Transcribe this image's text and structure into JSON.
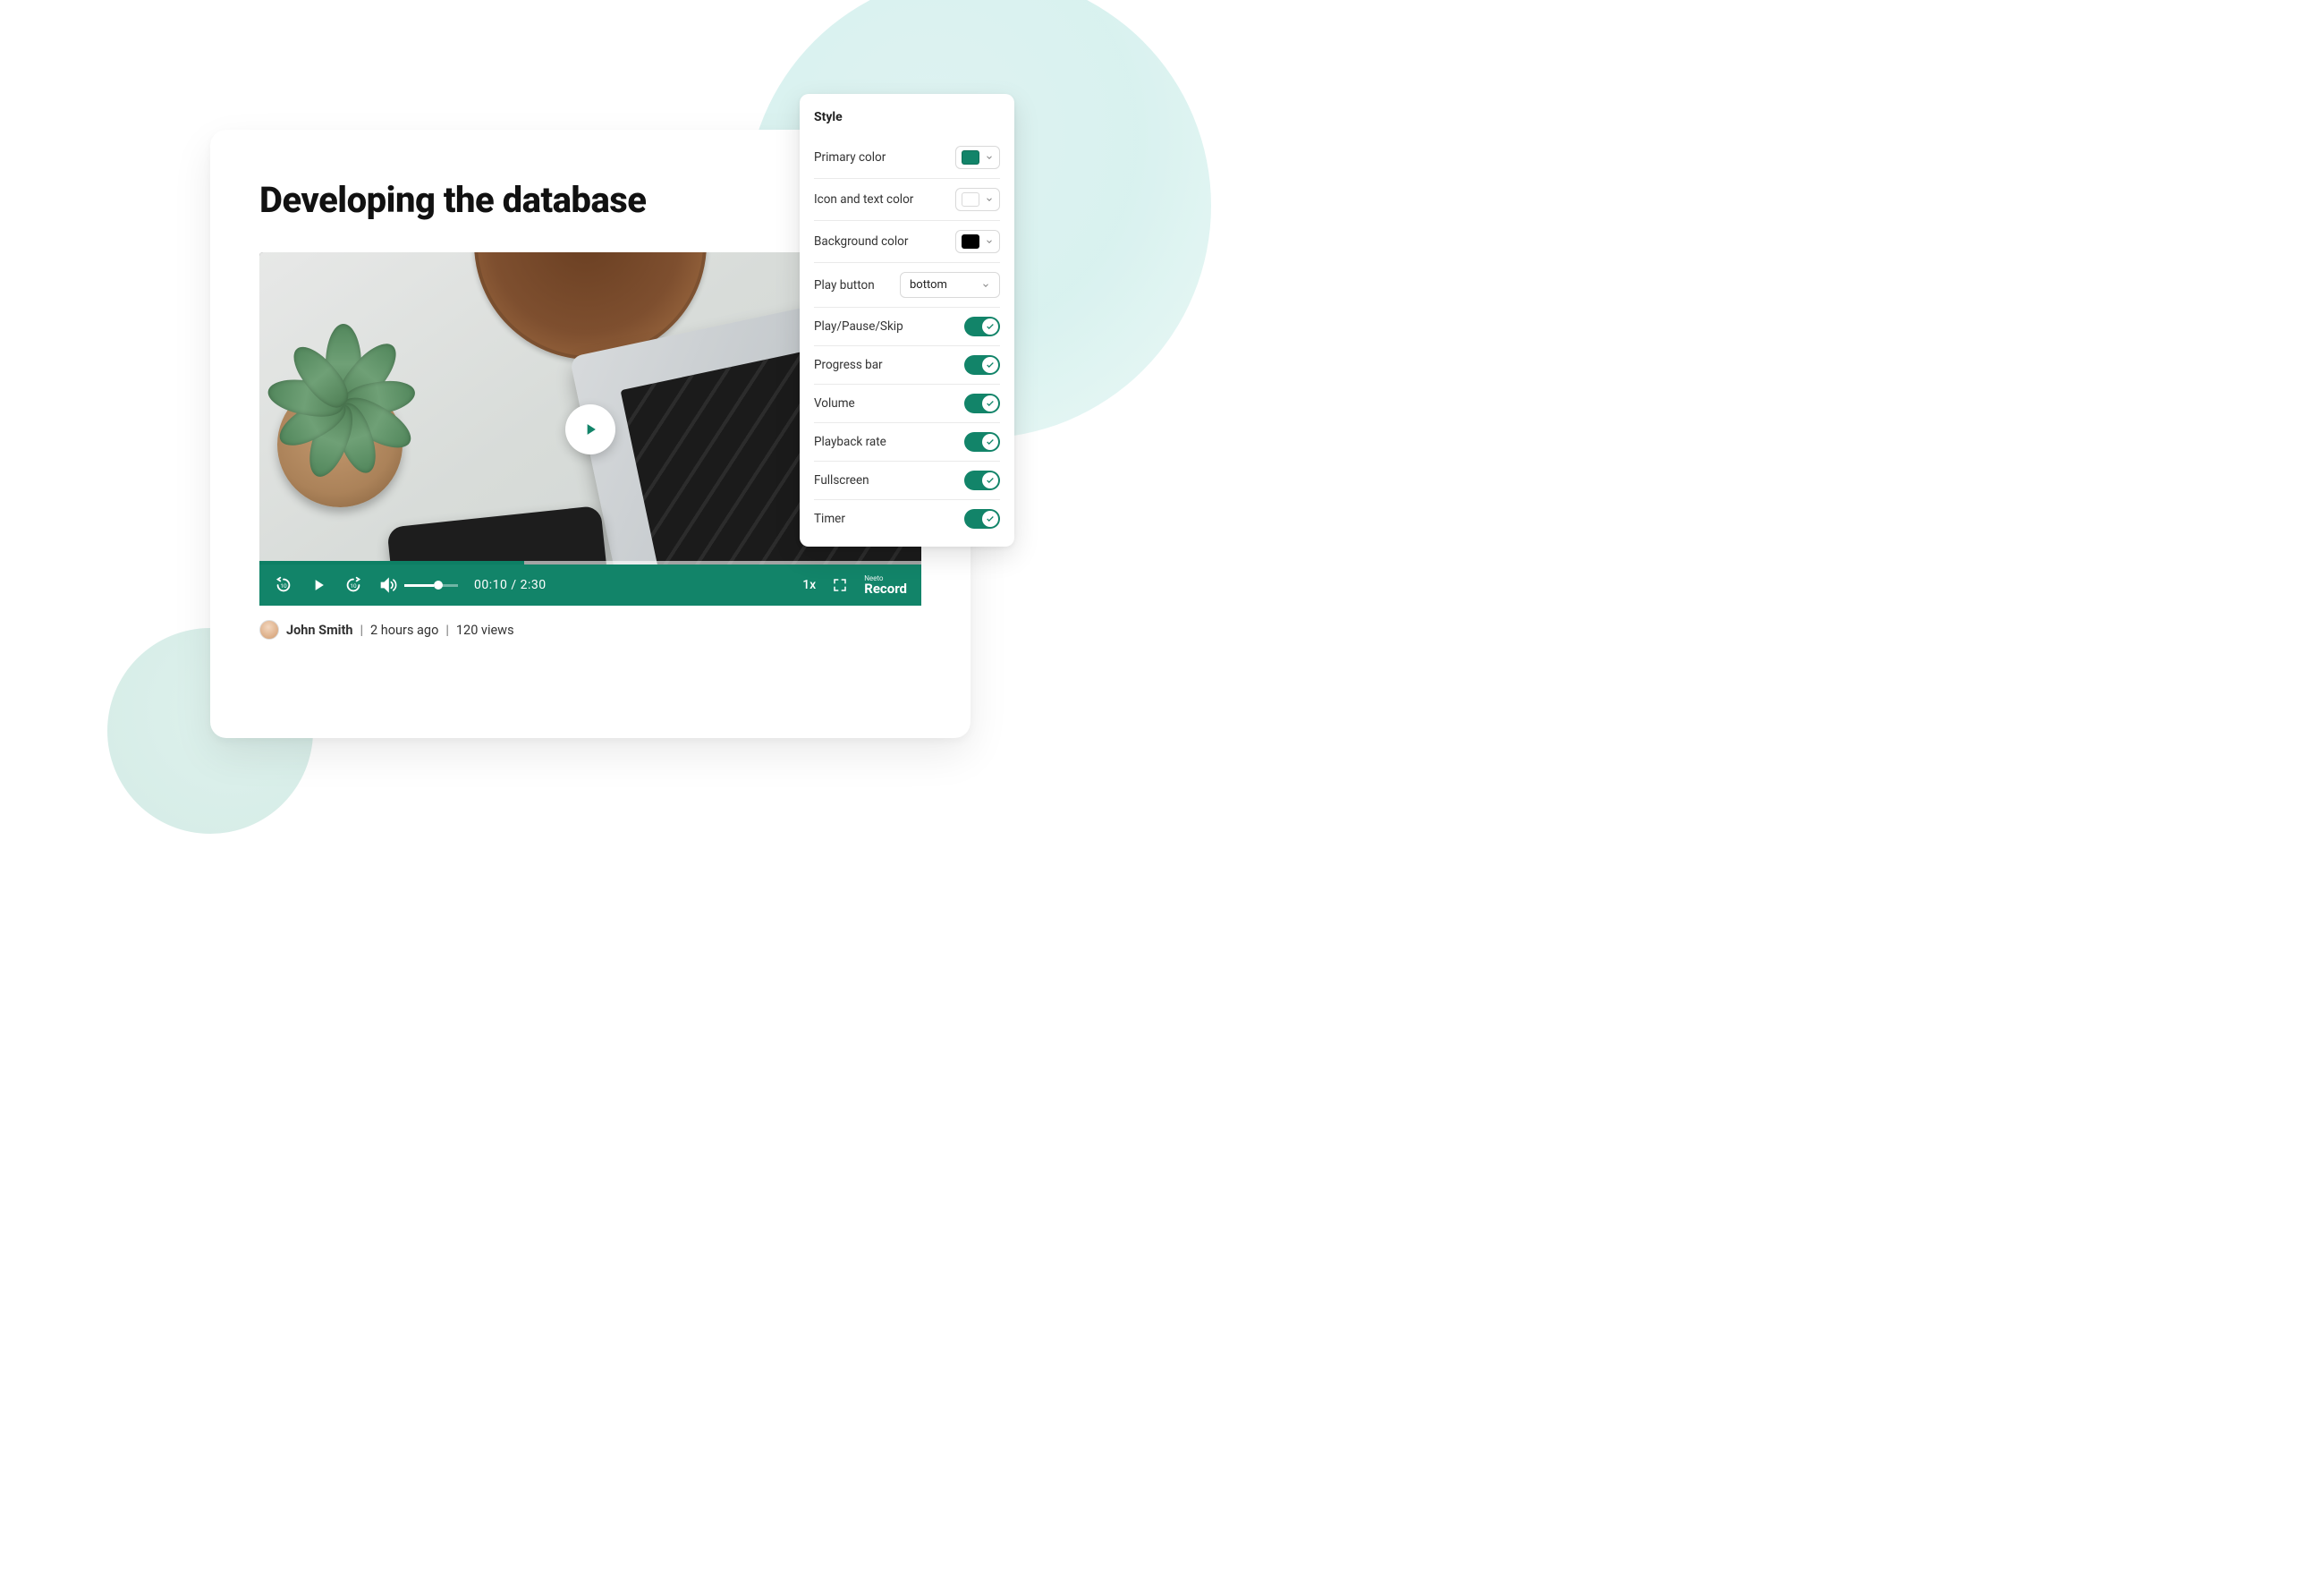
{
  "page": {
    "title": "Developing the database"
  },
  "player": {
    "timer": "00:10 / 2:30",
    "rate": "1x",
    "brand_small": "Neeto",
    "brand_big": "Record",
    "progress_percent": 40
  },
  "meta": {
    "author": "John Smith",
    "time_ago": "2 hours ago",
    "views": "120 views"
  },
  "style_panel": {
    "heading": "Style",
    "rows": {
      "primary_color": {
        "label": "Primary color",
        "color": "#128469"
      },
      "icon_text_color": {
        "label": "Icon and text color",
        "color": "#ffffff"
      },
      "background_color": {
        "label": "Background color",
        "color": "#000000"
      },
      "play_button": {
        "label": "Play button",
        "select_value": "bottom"
      },
      "play_pause_skip": {
        "label": "Play/Pause/Skip",
        "on": true
      },
      "progress_bar": {
        "label": "Progress bar",
        "on": true
      },
      "volume": {
        "label": "Volume",
        "on": true
      },
      "playback_rate": {
        "label": "Playback rate",
        "on": true
      },
      "fullscreen": {
        "label": "Fullscreen",
        "on": true
      },
      "timer": {
        "label": "Timer",
        "on": true
      }
    }
  }
}
